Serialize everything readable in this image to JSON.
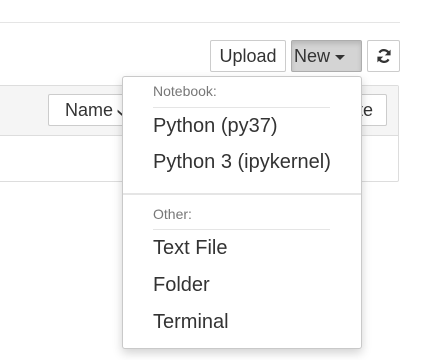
{
  "toolbar": {
    "upload_label": "Upload",
    "new_label": "New",
    "refresh_icon": "refresh-icon"
  },
  "file_list": {
    "sort_name_label": "Name",
    "sort_name_icon": "arrow-down-icon",
    "sort_modified_partial": "te"
  },
  "new_menu": {
    "notebook_header": "Notebook:",
    "notebook_items": [
      "Python (py37)",
      "Python 3 (ipykernel)"
    ],
    "other_header": "Other:",
    "other_items": [
      "Text File",
      "Folder",
      "Terminal"
    ]
  },
  "colors": {
    "active_button_bg": "#d4d4d4",
    "header_bg": "#f5f5f5",
    "muted_text": "#777777",
    "text": "#333333"
  }
}
